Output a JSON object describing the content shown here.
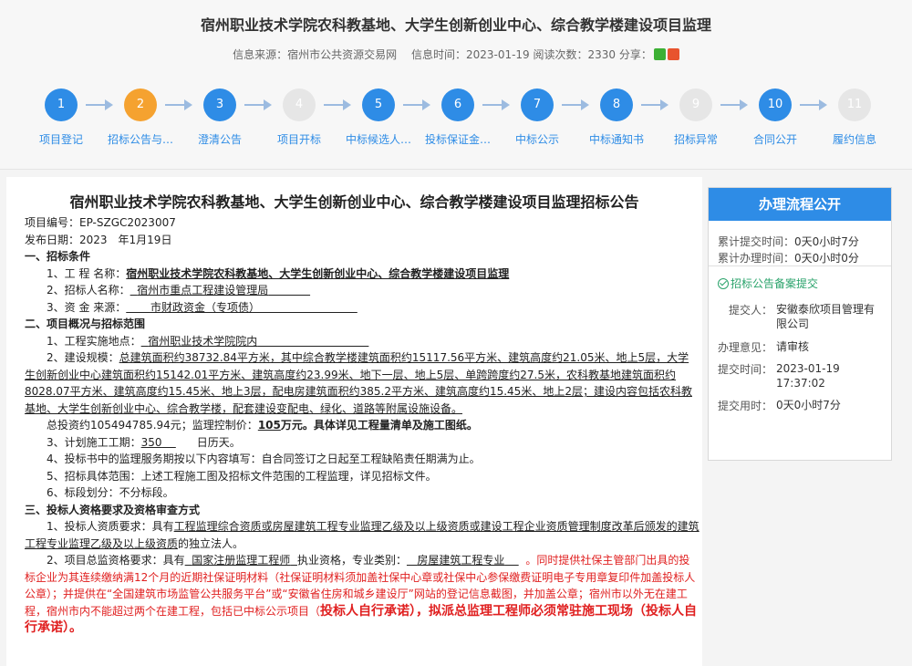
{
  "header": {
    "title": "宿州职业技术学院农科教基地、大学生创新创业中心、综合教学楼建设项目监理",
    "source": "信息来源：宿州市公共资源交易网",
    "info_time": "信息时间：2023-01-19 阅读次数：2330 分享："
  },
  "steps": [
    {
      "num": "1",
      "label": "项目登记",
      "state": "blue"
    },
    {
      "num": "2",
      "label": "招标公告与…",
      "state": "orange"
    },
    {
      "num": "3",
      "label": "澄清公告",
      "state": "blue"
    },
    {
      "num": "4",
      "label": "项目开标",
      "state": "grey"
    },
    {
      "num": "5",
      "label": "中标候选人…",
      "state": "blue"
    },
    {
      "num": "6",
      "label": "投标保证金…",
      "state": "blue"
    },
    {
      "num": "7",
      "label": "中标公示",
      "state": "blue"
    },
    {
      "num": "8",
      "label": "中标通知书",
      "state": "blue"
    },
    {
      "num": "9",
      "label": "招标异常",
      "state": "grey"
    },
    {
      "num": "10",
      "label": "合同公开",
      "state": "blue"
    },
    {
      "num": "11",
      "label": "履约信息",
      "state": "grey"
    }
  ],
  "doc": {
    "title": "宿州职业技术学院农科教基地、大学生创新创业中心、综合教学楼建设项目监理招标公告",
    "project_no": "项目编号：EP-SZGC2023007",
    "publish_date": "发布日期：2023　年1月19日",
    "s1": "一、招标条件",
    "s1_1_prefix": "1、工 程 名称：",
    "s1_1_value": "宿州职业技术学院农科教基地、大学生创新创业中心、综合教学楼建设项目监理",
    "s1_2_prefix": "2、招标人名称：",
    "s1_2_value": "宿州市重点工程建设管理局",
    "s1_3_prefix": "3、资 金 来源：",
    "s1_3_value": "市财政资金（专项债）",
    "s2": "二、项目概况与招标范围",
    "s2_1_prefix": "1、工程实施地点：",
    "s2_1_value": "宿州职业技术学院院内",
    "s2_2_prefix": "2、建设规模：",
    "s2_2_value": "总建筑面积约38732.84平方米，其中综合教学楼建筑面积约15117.56平方米、建筑高度约21.05米、地上5层，大学生创新创业中心建筑面积约15142.01平方米、建筑高度约23.99米、地下一层、地上5层、单跨跨度约27.5米，农科教基地建筑面积约8028.07平方米、建筑高度约15.45米、地上3层，配电房建筑面积约385.2平方米、建筑高度约15.45米、地上2层；建设内容包括农科教基地、大学生创新创业中心、综合教学楼，配套建设变配电、绿化、道路等附属设施设备。",
    "s2_invest_a": "总投资约105494785.94元；监理控制价：",
    "s2_invest_b": "105",
    "s2_invest_c": "万元。具体详见工程量清单及施工图纸。",
    "s2_3_a": "3、计划施工工期：",
    "s2_3_b": "350",
    "s2_3_c": "日历天。",
    "s2_4": "4、投标书中的监理服务期按以下内容填写：自合同签订之日起至工程缺陷责任期满为止。",
    "s2_5": "5、招标具体范围：上述工程施工图及招标文件范围的工程监理，详见招标文件。",
    "s2_6": "6、标段划分：不分标段。",
    "s3": "三、投标人资格要求及资格审查方式",
    "s3_1_prefix": "1、投标人资质要求：具有",
    "s3_1_value": "工程监理综合资质或房屋建筑工程专业监理乙级及以上级资质或建设工程企业资质管理制度改革后颁发的建筑工程专业监理乙级及以上级资质",
    "s3_1_suffix": "的独立法人。",
    "s3_2_a": "2、项目总监资格要求：具有",
    "s3_2_b": "国家注册监理工程师",
    "s3_2_c": "执业资格，专业类别：",
    "s3_2_d": "房屋建筑工程专业",
    "s3_2_e": "。同时提供社保主管部门出具的投标企业为其连续缴纳满12个月的近期社保证明材料（社保证明材料须加盖社保中心章或社保中心参保缴费证明电子专用章复印件加盖投标人公章）；并提供在“全国建筑市场监管公共服务平台”或“安徽省住房和城乡建设厅”网站的登记信息截图，并加盖公章；宿州市以外无在建工程，宿州市内不能超过两个在建工程，包括已中标公示项目（",
    "s3_2_f": "投标人自行承诺），拟派总监理工程师必须常驻施工现场（投标人自行承诺）。"
  },
  "sidebar": {
    "title": "办理流程公开",
    "submit_time_label": "累计提交时间：",
    "submit_time_value": "0天0小时7分",
    "handle_time_label": "累计办理时间：",
    "handle_time_value": "0天0小时0分",
    "item_title": "招标公告备案提交",
    "submitter_label": "提交人：",
    "submitter_value": "安徽泰欣项目管理有限公司",
    "opinion_label": "办理意见：",
    "opinion_value": "请审核",
    "submit_at_label": "提交时间：",
    "submit_at_value": "2023-01-19 17:37:02",
    "duration_label": "提交用时：",
    "duration_value": "0天0小时7分"
  },
  "colors": {
    "primary": "#2e8ce6",
    "current_step": "#f5a230",
    "inactive_step": "#e6e6e6",
    "highlight_red": "#e02020",
    "done_green": "#2aa36b"
  }
}
